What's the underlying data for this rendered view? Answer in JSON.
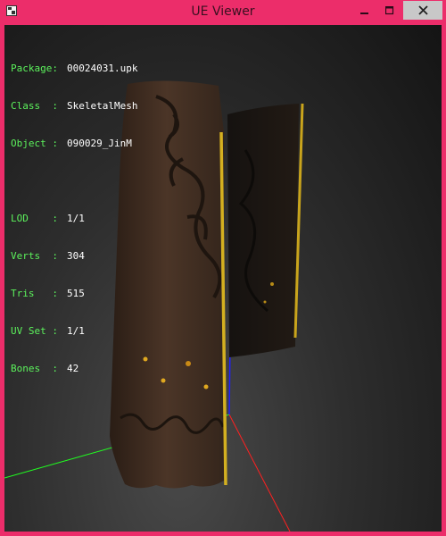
{
  "window": {
    "title": "UE Viewer"
  },
  "titlebar": {
    "icon": "ue-viewer-app-icon",
    "buttons": [
      "minimize-icon",
      "maximize-icon",
      "close-icon"
    ]
  },
  "info": {
    "package_label": "Package:",
    "package_value": "00024031.upk",
    "class_label": "Class  :",
    "class_value": "SkeletalMesh",
    "object_label": "Object :",
    "object_value": "090029_JinM",
    "lod_label": "LOD    :",
    "lod_value": "1/1",
    "verts_label": "Verts  :",
    "verts_value": "304",
    "tris_label": "Tris   :",
    "tris_value": "515",
    "uvset_label": "UV Set :",
    "uvset_value": "1/1",
    "bones_label": "Bones  :",
    "bones_value": "42"
  },
  "colors": {
    "frame": "#ec2d6a",
    "label_text": "#5cf25c",
    "value_text": "#ffffff",
    "axis_x": "#ff2020",
    "axis_y": "#20ff20",
    "axis_z": "#2020ff",
    "mesh_edge": "#d4b020"
  }
}
